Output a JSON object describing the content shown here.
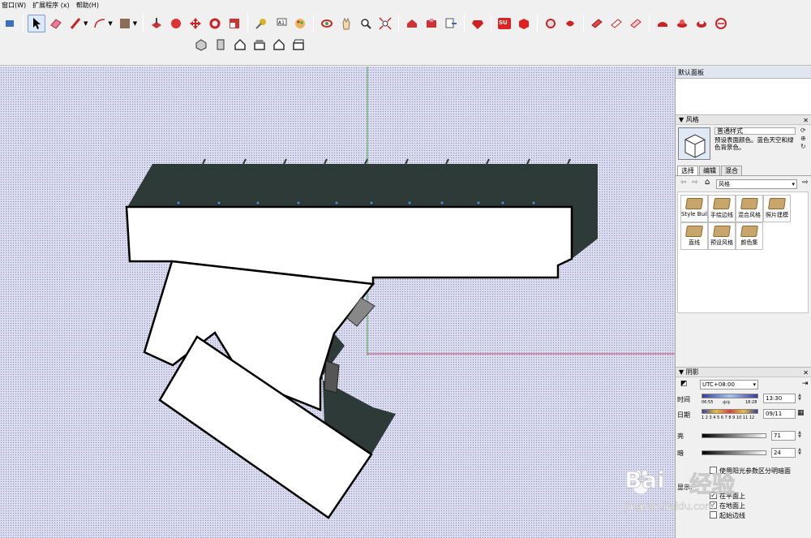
{
  "menubar": {
    "items": [
      "窗口(W)",
      "扩展程序 (x)",
      "帮助(H)"
    ]
  },
  "toolbar": {
    "row1_icons": [
      "select-icon",
      "eraser-icon",
      "pencil-icon",
      "arc-icon",
      "paint-bucket-icon",
      "push-pull-icon",
      "follow-me-icon",
      "move-icon",
      "rotate-icon",
      "scale-icon",
      "tape-measure-icon",
      "text-icon",
      "paint-icon",
      "orbit-icon",
      "pan-icon",
      "zoom-icon",
      "zoom-extents-icon",
      "warehouse-icon",
      "extension-warehouse-icon",
      "send-to-layout-icon",
      "ruby-icon",
      "su-app-icon",
      "solid-icon",
      "camera-icon",
      "walk-icon",
      "section-plane-icon",
      "section-display-icon",
      "section-cut-icon",
      "sandbox-icon",
      "stamp-icon",
      "drape-icon",
      "add-detail-icon"
    ],
    "row2_icons": [
      "iso-view-icon",
      "top-view-icon",
      "front-view-icon",
      "right-view-icon",
      "back-view-icon",
      "left-view-icon"
    ]
  },
  "panel": {
    "title": "默认面板",
    "styles": {
      "header": "风格",
      "style_name": "普通样式",
      "style_desc": "预设表面颜色。蓝色天空和绿色背景色。",
      "tabs": [
        "选择",
        "编辑",
        "混合"
      ],
      "current_collection": "风格",
      "collections": [
        "Style Buil",
        "手绘边线",
        "混合风格",
        "照片建模",
        "直线",
        "预设风格",
        "颜色集"
      ]
    },
    "shadows": {
      "header": "阴影",
      "timezone": "UTC+08:00",
      "time_label": "时间",
      "time_start": "06:55",
      "time_mid": "中午",
      "time_end": "18:28",
      "time_value": "13:30",
      "date_label": "日期",
      "months": "1 2 3 4 5 6 7 8 9 10 11 12",
      "date_value": "09/11",
      "light_label": "亮",
      "light_value": "71",
      "dark_label": "暗",
      "dark_value": "24",
      "use_sun_label": "使用阳光参数区分明暗面",
      "display_label": "显示:",
      "on_faces": "在平面上",
      "on_ground": "在地面上",
      "from_edges": "起始边线"
    }
  },
  "watermark": {
    "brand": "Bai",
    "brand2": "经验",
    "url": "jingyan.baidu.com"
  },
  "colors": {
    "accent": "#7a9cd3",
    "shadow_face": "#2e3a38",
    "viewport_bg": "#dcdcf0",
    "axis_green": "#3fa63f",
    "axis_red": "#c44060"
  }
}
